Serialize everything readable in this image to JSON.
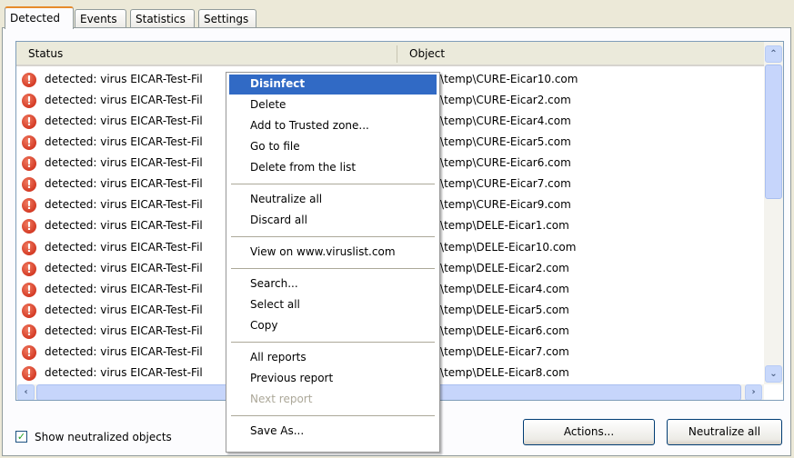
{
  "tabs": [
    "Detected",
    "Events",
    "Statistics",
    "Settings"
  ],
  "columns": {
    "status": "Status",
    "object": "Object"
  },
  "rows": [
    {
      "status": "detected: virus EICAR-Test-Fil",
      "object": ":\\temp\\CURE-Eicar10.com"
    },
    {
      "status": "detected: virus EICAR-Test-Fil",
      "object": ":\\temp\\CURE-Eicar2.com"
    },
    {
      "status": "detected: virus EICAR-Test-Fil",
      "object": ":\\temp\\CURE-Eicar4.com"
    },
    {
      "status": "detected: virus EICAR-Test-Fil",
      "object": ":\\temp\\CURE-Eicar5.com"
    },
    {
      "status": "detected: virus EICAR-Test-Fil",
      "object": ":\\temp\\CURE-Eicar6.com"
    },
    {
      "status": "detected: virus EICAR-Test-Fil",
      "object": ":\\temp\\CURE-Eicar7.com"
    },
    {
      "status": "detected: virus EICAR-Test-Fil",
      "object": ":\\temp\\CURE-Eicar9.com"
    },
    {
      "status": "detected: virus EICAR-Test-Fil",
      "object": ":\\temp\\DELE-Eicar1.com"
    },
    {
      "status": "detected: virus EICAR-Test-Fil",
      "object": ":\\temp\\DELE-Eicar10.com"
    },
    {
      "status": "detected: virus EICAR-Test-Fil",
      "object": ":\\temp\\DELE-Eicar2.com"
    },
    {
      "status": "detected: virus EICAR-Test-Fil",
      "object": ":\\temp\\DELE-Eicar4.com"
    },
    {
      "status": "detected: virus EICAR-Test-Fil",
      "object": ":\\temp\\DELE-Eicar5.com"
    },
    {
      "status": "detected: virus EICAR-Test-Fil",
      "object": ":\\temp\\DELE-Eicar6.com"
    },
    {
      "status": "detected: virus EICAR-Test-Fil",
      "object": ":\\temp\\DELE-Eicar7.com"
    },
    {
      "status": "detected: virus EICAR-Test-Fil",
      "object": ":\\temp\\DELE-Eicar8.com"
    }
  ],
  "menu": [
    {
      "label": "Disinfect",
      "state": "highlighted"
    },
    {
      "label": "Delete"
    },
    {
      "label": "Add to Trusted zone..."
    },
    {
      "label": "Go to file"
    },
    {
      "label": "Delete from the list"
    },
    {
      "sep": true
    },
    {
      "label": "Neutralize all"
    },
    {
      "label": "Discard all"
    },
    {
      "sep": true
    },
    {
      "label": "View on www.viruslist.com"
    },
    {
      "sep": true
    },
    {
      "label": "Search..."
    },
    {
      "label": "Select all"
    },
    {
      "label": "Copy"
    },
    {
      "sep": true
    },
    {
      "label": "All reports"
    },
    {
      "label": "Previous report"
    },
    {
      "label": "Next report",
      "state": "disabled"
    },
    {
      "sep": true
    },
    {
      "label": "Save As..."
    }
  ],
  "checkbox": {
    "label": "Show neutralized objects",
    "checked": true
  },
  "buttons": {
    "actions": "Actions...",
    "neutralize_all": "Neutralize all"
  }
}
